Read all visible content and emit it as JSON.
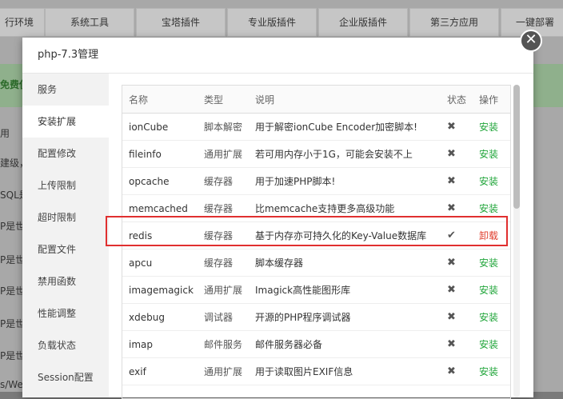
{
  "background": {
    "tabs": [
      "行环境",
      "系统工具",
      "宝塔插件",
      "专业版插件",
      "企业版插件",
      "第三方应用",
      "一键部署"
    ],
    "green_banner_text": "免费使",
    "left_text": [
      "用",
      "建级，",
      "SQL是",
      "P是世",
      "P是世",
      "P是世",
      "P是世",
      "P是世",
      "s/Web"
    ]
  },
  "modal": {
    "title": "php-7.3管理",
    "close_symbol": "✕"
  },
  "sidebar": {
    "items": [
      {
        "label": "服务"
      },
      {
        "label": "安装扩展"
      },
      {
        "label": "配置修改"
      },
      {
        "label": "上传限制"
      },
      {
        "label": "超时限制"
      },
      {
        "label": "配置文件"
      },
      {
        "label": "禁用函数"
      },
      {
        "label": "性能调整"
      },
      {
        "label": "负载状态"
      },
      {
        "label": "Session配置"
      }
    ],
    "active_index": 1
  },
  "table": {
    "headers": {
      "name": "名称",
      "type": "类型",
      "desc": "说明",
      "status": "状态",
      "op": "操作"
    },
    "rows": [
      {
        "name": "ionCube",
        "type": "脚本解密",
        "desc": "用于解密ionCube Encoder加密脚本!",
        "status": "✖",
        "op": "安装"
      },
      {
        "name": "fileinfo",
        "type": "通用扩展",
        "desc": "若可用内存小于1G，可能会安装不上",
        "status": "✖",
        "op": "安装"
      },
      {
        "name": "opcache",
        "type": "缓存器",
        "desc": "用于加速PHP脚本!",
        "status": "✖",
        "op": "安装"
      },
      {
        "name": "memcached",
        "type": "缓存器",
        "desc": "比memcache支持更多高级功能",
        "status": "✖",
        "op": "安装"
      },
      {
        "name": "redis",
        "type": "缓存器",
        "desc": "基于内存亦可持久化的Key-Value数据库",
        "status": "✔",
        "op": "卸载"
      },
      {
        "name": "apcu",
        "type": "缓存器",
        "desc": "脚本缓存器",
        "status": "✖",
        "op": "安装"
      },
      {
        "name": "imagemagick",
        "type": "通用扩展",
        "desc": "Imagick高性能图形库",
        "status": "✖",
        "op": "安装"
      },
      {
        "name": "xdebug",
        "type": "调试器",
        "desc": "开源的PHP程序调试器",
        "status": "✖",
        "op": "安装"
      },
      {
        "name": "imap",
        "type": "邮件服务",
        "desc": "邮件服务器必备",
        "status": "✖",
        "op": "安装"
      },
      {
        "name": "exif",
        "type": "通用扩展",
        "desc": "用于读取图片EXIF信息",
        "status": "✖",
        "op": "安装"
      }
    ]
  },
  "colors": {
    "install": "#20a53a",
    "uninstall": "#e03e2d",
    "highlight": "#e02f2f"
  }
}
